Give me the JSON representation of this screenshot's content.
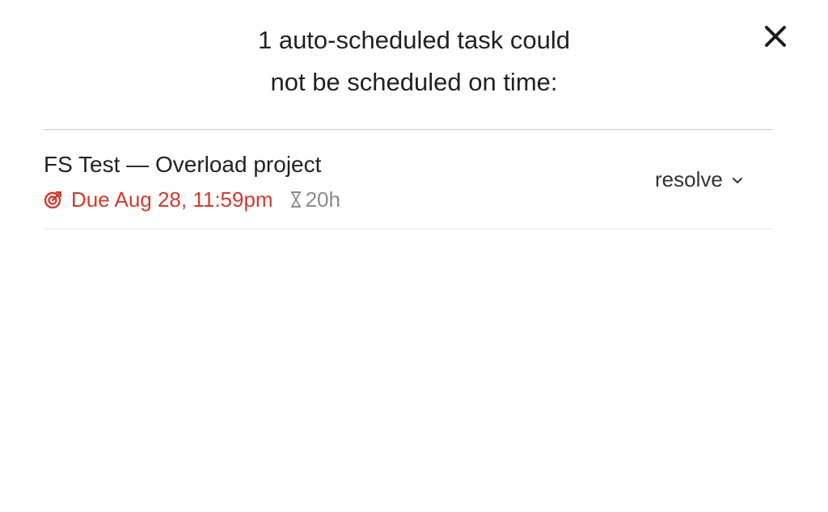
{
  "dialog": {
    "title_line1": "1 auto-scheduled task could",
    "title_line2": "not be scheduled on time:",
    "close_icon": "close-icon"
  },
  "tasks": [
    {
      "name": "FS Test — Overload project",
      "due": "Due Aug 28, 11:59pm",
      "due_icon": "target-icon",
      "duration": "20h",
      "duration_icon": "hourglass-icon",
      "action_label": "resolve",
      "action_icon": "chevron-down-icon"
    }
  ],
  "colors": {
    "due": "#d23b2a",
    "duration": "#8a8a8a",
    "text": "#222222"
  }
}
